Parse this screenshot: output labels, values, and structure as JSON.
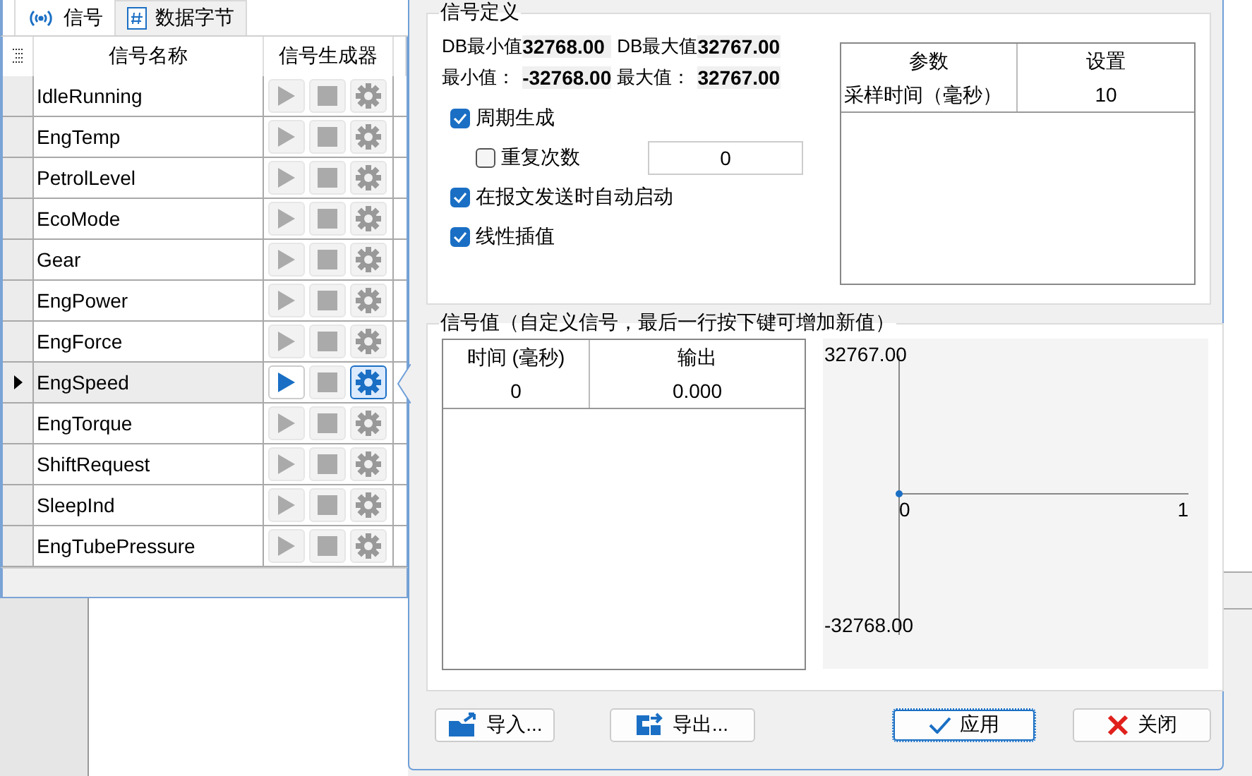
{
  "tabs": [
    {
      "label": "信号",
      "kind": "signal",
      "selected": true
    },
    {
      "label": "数据字节",
      "kind": "hash",
      "selected": false
    }
  ],
  "signal_table": {
    "columns": [
      "信号名称",
      "信号生成器"
    ],
    "rows": [
      {
        "name": "IdleRunning",
        "selected": false
      },
      {
        "name": "EngTemp",
        "selected": false
      },
      {
        "name": "PetrolLevel",
        "selected": false
      },
      {
        "name": "EcoMode",
        "selected": false
      },
      {
        "name": "Gear",
        "selected": false
      },
      {
        "name": "EngPower",
        "selected": false
      },
      {
        "name": "EngForce",
        "selected": false
      },
      {
        "name": "EngSpeed",
        "selected": true
      },
      {
        "name": "EngTorque",
        "selected": false
      },
      {
        "name": "ShiftRequest",
        "selected": false
      },
      {
        "name": "SleepInd",
        "selected": false
      },
      {
        "name": "EngTubePressure",
        "selected": false
      }
    ]
  },
  "definition": {
    "title": "信号定义",
    "limits": [
      {
        "label": "DB最小值",
        "value": "32768.00"
      },
      {
        "label": "DB最大值",
        "value": "32767.00"
      },
      {
        "label": "最小值：",
        "value": "-32768.00"
      },
      {
        "label": "最大值：",
        "value": "32767.00"
      }
    ],
    "options": [
      {
        "label": "周期生成",
        "checked": true,
        "children": [
          {
            "label": "重复次数",
            "checked": false,
            "value": "0"
          }
        ]
      },
      {
        "label": "在报文发送时自动启动",
        "checked": true
      },
      {
        "label": "线性插值",
        "checked": true
      }
    ],
    "parameters": {
      "columns": [
        "参数",
        "设置"
      ],
      "rows": [
        [
          "采样时间（毫秒）",
          "10"
        ]
      ]
    }
  },
  "values": {
    "title": "信号值（自定义信号，最后一行按下键可增加新值）",
    "columns": [
      "时间 (毫秒)",
      "输出"
    ],
    "rows": [
      [
        "0",
        "0.000"
      ]
    ],
    "chart_data": {
      "type": "line",
      "x": [
        0
      ],
      "series": [
        {
          "values": [
            0
          ],
          "marker": true
        }
      ],
      "xlim": [
        0,
        1
      ],
      "ylim": [
        -32768,
        32767
      ],
      "xticks": [
        0,
        1
      ],
      "yticks": [
        {
          "value": 32767,
          "label": "32767.00"
        },
        {
          "value": -32768,
          "label": "-32768.00"
        }
      ]
    }
  },
  "buttons": [
    {
      "label": "导入...",
      "kind": "import"
    },
    {
      "label": "导出...",
      "kind": "export"
    },
    {
      "label": "应用",
      "kind": "apply"
    },
    {
      "label": "关闭",
      "kind": "close"
    }
  ]
}
